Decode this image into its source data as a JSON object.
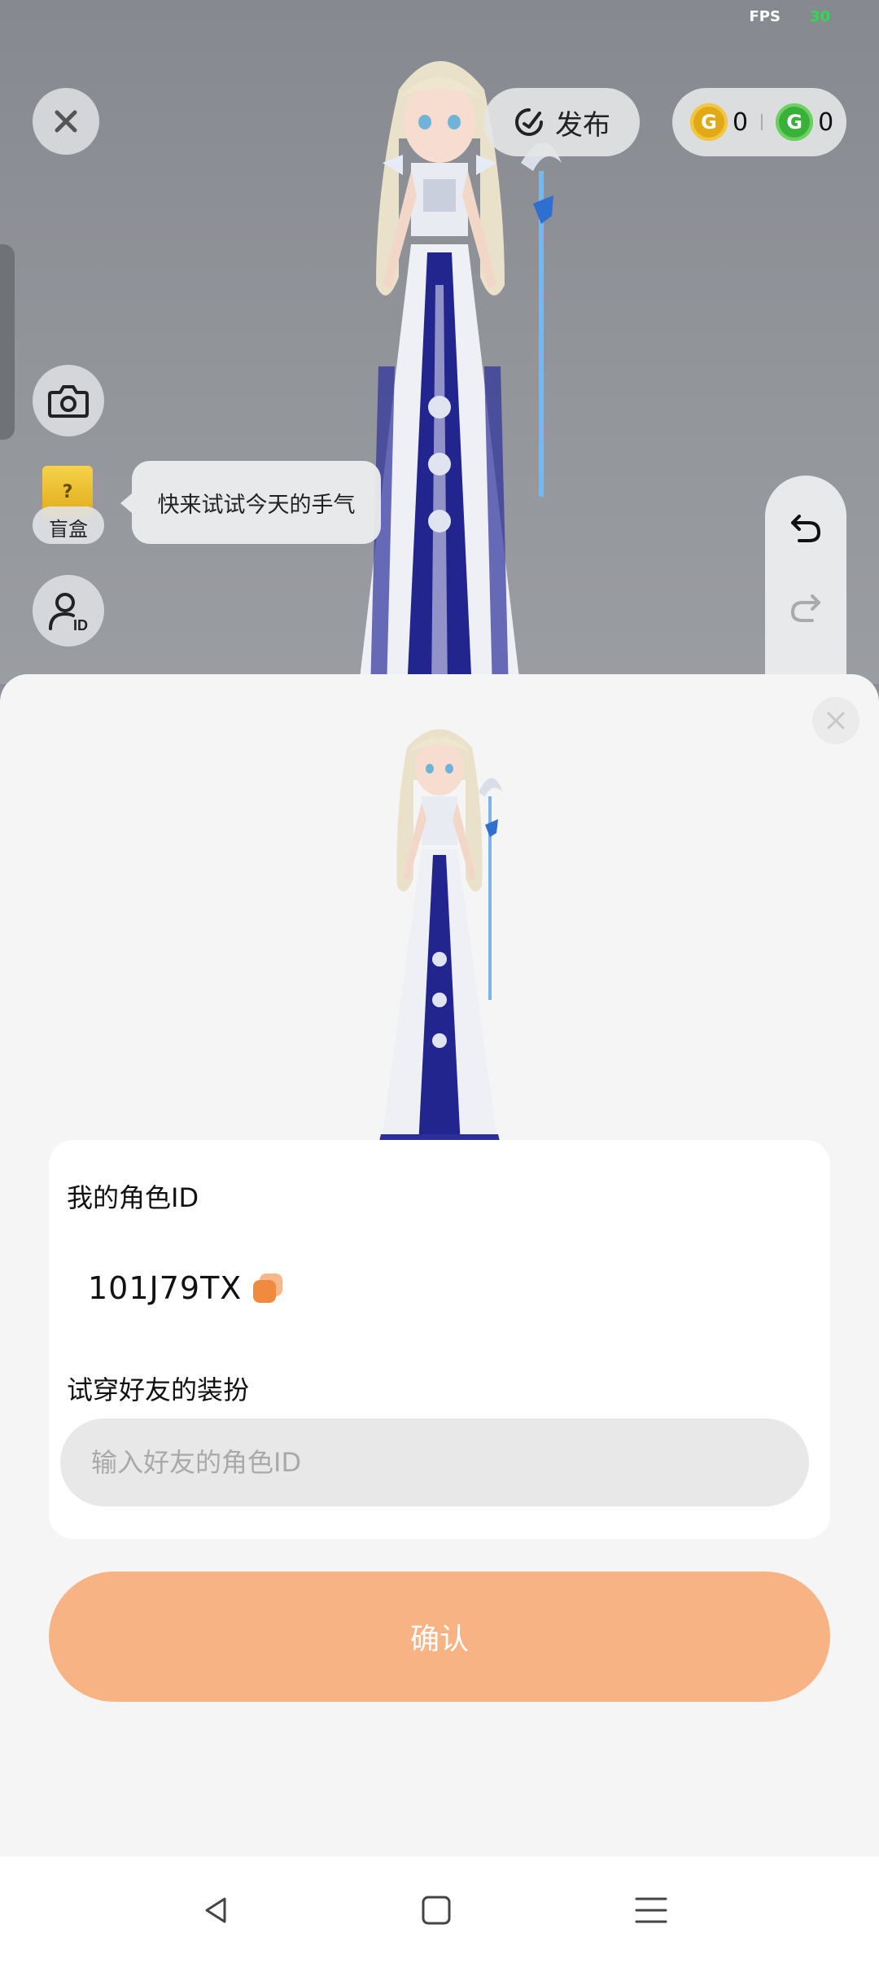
{
  "status": {
    "fps_label": "FPS",
    "fps_value": "30"
  },
  "toolbar": {
    "publish_label": "发布",
    "gold_coins": "0",
    "green_coins": "0"
  },
  "side": {
    "blindbox_label": "盲盒",
    "bubble_text": "快来试试今天的手气"
  },
  "sheet": {
    "my_id_title": "我的角色ID",
    "my_id_value": "101J79TX",
    "tryon_title": "试穿好友的装扮",
    "friend_id_placeholder": "输入好友的角色ID",
    "friend_id_value": "",
    "confirm_label": "确认"
  },
  "colors": {
    "accent": "#f7b384",
    "copy_icon": "#f08a3e",
    "fps_value": "#2ddc4a",
    "gold_coin": "#e2a917",
    "green_coin": "#38b03a"
  },
  "icons": [
    "close-icon",
    "publish-icon",
    "gold-coin-icon",
    "green-coin-icon",
    "camera-icon",
    "blindbox-icon",
    "character-id-icon",
    "undo-icon",
    "redo-icon",
    "copy-icon",
    "back-nav-icon",
    "home-nav-icon",
    "menu-nav-icon"
  ]
}
